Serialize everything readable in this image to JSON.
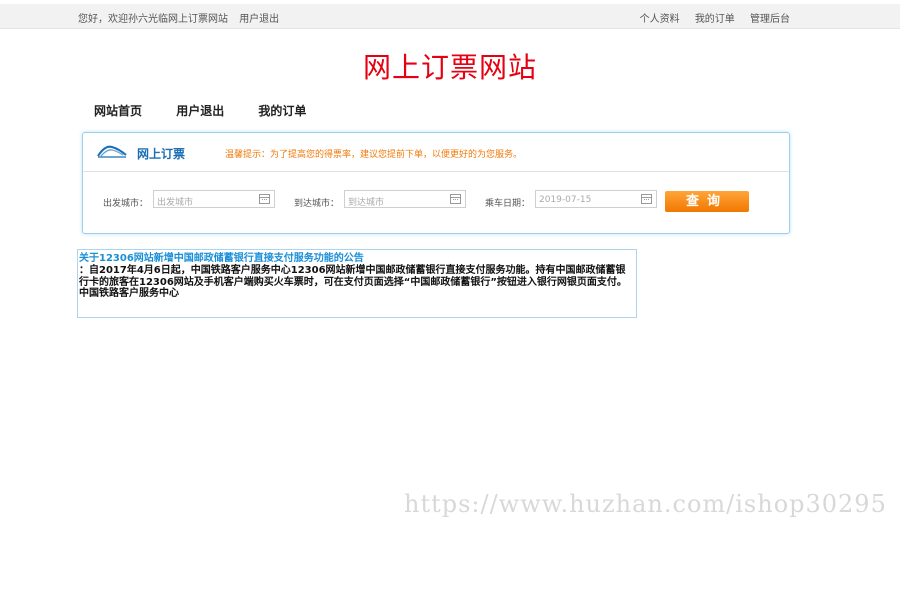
{
  "topbar": {
    "welcome": "您好，欢迎孙六光临网上订票网站",
    "logout": "用户退出",
    "links": [
      "个人资料",
      "我的订单",
      "管理后台"
    ]
  },
  "site_title": "网上订票网站",
  "nav": {
    "items": [
      "网站首页",
      "用户退出",
      "我的订单"
    ]
  },
  "booking": {
    "title": "网上订票",
    "tip": "温馨提示：为了提高您的得票率，建议您提前下单，以便更好的为您服务。",
    "from_label": "出发城市：",
    "from_placeholder": "出发城市",
    "to_label": "到达城市：",
    "to_placeholder": "到达城市",
    "date_label": "乘车日期：",
    "date_value": "2019-07-15",
    "search_label": "查询"
  },
  "notice": {
    "title": "关于12306网站新增中国邮政储蓄银行直接支付服务功能的公告",
    "body": "：自2017年4月6日起，中国铁路客户服务中心12306网站新增中国邮政储蓄银行直接支付服务功能。持有中国邮政储蓄银行卡的旅客在12306网站及手机客户端购买火车票时，可在支付页面选择“中国邮政储蓄银行”按钮进入银行网银页面支付。 中国铁路客户服务中心"
  },
  "watermark": "https://www.huzhan.com/ishop30295",
  "icons": {
    "booking_logo": "train-logo-icon",
    "calendar": "calendar-icon"
  },
  "colors": {
    "title_red": "#e60012",
    "link_blue": "#1a6fb5",
    "tip_orange": "#f07a0a",
    "button_orange": "#f58a1f"
  }
}
